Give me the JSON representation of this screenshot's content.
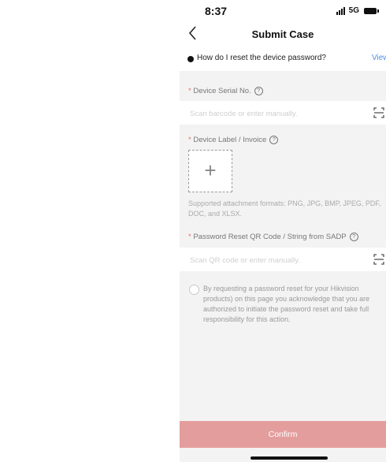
{
  "status": {
    "time": "8:37",
    "network": "5G"
  },
  "nav": {
    "title": "Submit Case"
  },
  "faq": {
    "text": "How do I reset the device password?",
    "link": "View"
  },
  "serial": {
    "label": "Device Serial No.",
    "placeholder": "Scan barcode or enter manually."
  },
  "label_invoice": {
    "label": "Device Label / Invoice",
    "upload": "+",
    "hint": "Supported attachment formats: PNG, JPG, BMP, JPEG, PDF, DOC, and XLSX."
  },
  "qr": {
    "label": "Password Reset QR Code / String from SADP",
    "placeholder": "Scan QR code or enter manually."
  },
  "agreement": "By requesting a password reset for your Hikvision products) on this page you acknowledge that you are authorized to initiate the password reset and take full responsibility for this action.",
  "confirm": "Confirm",
  "colors": {
    "confirm_bg": "#e49d9d",
    "link": "#4a90e2",
    "required": "#e86a6a"
  },
  "icons": [
    "back-icon",
    "scan-icon",
    "help-icon",
    "signal-icon",
    "battery-icon"
  ]
}
